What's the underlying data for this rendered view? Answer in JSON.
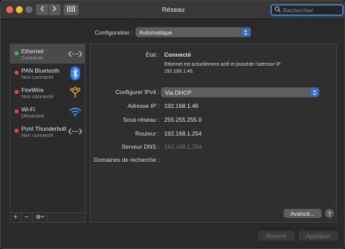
{
  "window": {
    "title": "Réseau"
  },
  "toolbar": {
    "back_icon": "chevron-left-icon",
    "forward_icon": "chevron-right-icon",
    "grid_icon": "grid-icon"
  },
  "search": {
    "placeholder": "Rechercher"
  },
  "location": {
    "label": "Configuration :",
    "value": "Automatique"
  },
  "services": [
    {
      "name": "Ethernet",
      "status": "Connecté",
      "status_color": "#2fc246",
      "icon": "ethernet-icon",
      "selected": true
    },
    {
      "name": "PAN Bluetooth",
      "status": "Non connecté",
      "status_color": "#f0403a",
      "icon": "bluetooth-icon"
    },
    {
      "name": "FireWire",
      "status": "Non connecté",
      "status_color": "#f0403a",
      "icon": "firewire-icon"
    },
    {
      "name": "Wi-Fi",
      "status": "Désactivé",
      "status_color": "#f0403a",
      "icon": "wifi-icon"
    },
    {
      "name": "Pont Thunderbolt",
      "status": "Non connecté",
      "status_color": "#f0403a",
      "icon": "thunderbolt-bridge-icon"
    }
  ],
  "sidebar_actions": {
    "add": "+",
    "remove": "−",
    "actions_icon": "gear-icon"
  },
  "detail": {
    "state_label": "État :",
    "state_value": "Connecté",
    "state_note": "Ethernet est actuellement actif et possède l'adresse IP 192.168.1.46.",
    "ipv4_label": "Configurer IPv4 :",
    "ipv4_value": "Via DHCP",
    "ip_label": "Adresse IP :",
    "ip_value": "192.168.1.46",
    "mask_label": "Sous-réseau :",
    "mask_value": "255.255.255.0",
    "router_label": "Routeur :",
    "router_value": "192.168.1.254",
    "dns_label": "Serveur DNS :",
    "dns_value": "192.168.1.254",
    "search_domains_label": "Domaines de recherche :",
    "advanced_button": "Avancé...",
    "help_button": "?"
  },
  "footer": {
    "revert": "Revenir",
    "apply": "Appliquer"
  },
  "colors": {
    "accent": "#2f6fe0",
    "connected": "#2fc246",
    "disconnected": "#f0403a",
    "bluetooth": "#2f7bf0",
    "firewire": "#f0b42a",
    "wifi": "#4a9bf5"
  }
}
